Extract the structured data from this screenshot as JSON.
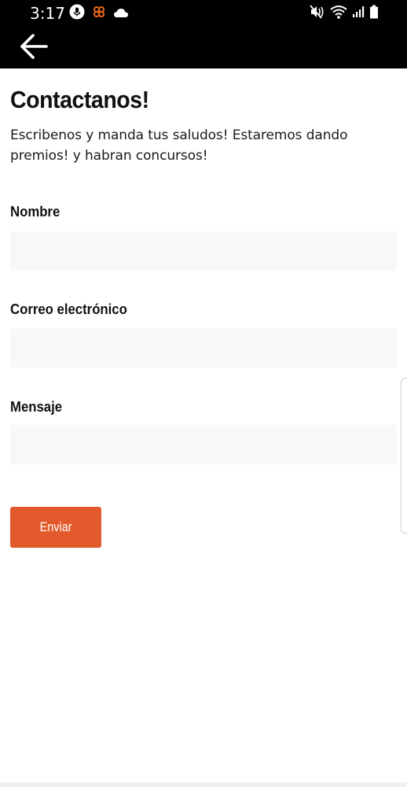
{
  "status_bar": {
    "time": "3:17",
    "icons_left": [
      "microphone-icon",
      "app-notification-icon",
      "cloud-icon"
    ],
    "icons_right": [
      "mute-icon",
      "wifi-icon",
      "signal-icon",
      "battery-icon"
    ],
    "notification_color": "#e8661a"
  },
  "app_bar": {
    "back_icon": "arrow-left-icon"
  },
  "page": {
    "title": "Contactanos!",
    "subtitle": "Escribenos y manda tus saludos! Estaremos dando premios! y habran concursos!"
  },
  "form": {
    "name_label": "Nombre",
    "name_value": "",
    "email_label": "Correo electrónico",
    "email_value": "",
    "message_label": "Mensaje",
    "message_value": "",
    "submit_label": "Enviar"
  },
  "colors": {
    "accent": "#e25a2c",
    "input_bg": "#f8f7fa",
    "bar_bg": "#000000"
  }
}
